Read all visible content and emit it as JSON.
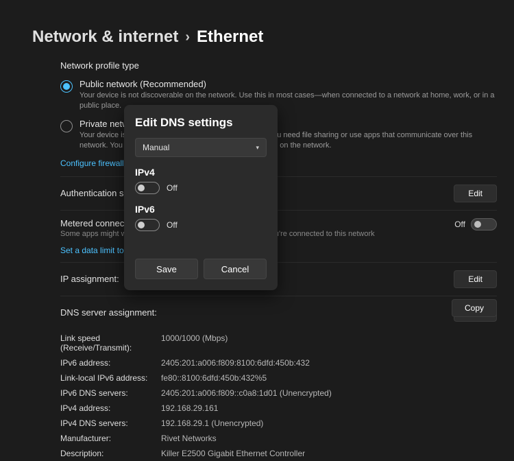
{
  "breadcrumb": {
    "parent": "Network & internet",
    "separator": "›",
    "current": "Ethernet"
  },
  "profile": {
    "section_label": "Network profile type",
    "public": {
      "title": "Public network (Recommended)",
      "desc": "Your device is not discoverable on the network. Use this in most cases—when connected to a network at home, work, or in a public place."
    },
    "private": {
      "title": "Private network",
      "desc": "Your device is discoverable on the network. Select this if you need file sharing or use apps that communicate over this network. You should know and trust the people and devices on the network."
    },
    "firewall_link": "Configure firewall and security settings"
  },
  "rows": {
    "auth": {
      "label": "Authentication settings",
      "button": "Edit"
    },
    "metered": {
      "label": "Metered connection",
      "desc": "Some apps might work differently to reduce data usage when you're connected to this network",
      "toggle_label": "Off"
    },
    "data_limit_link": "Set a data limit to help control data usage on this network",
    "ip": {
      "label": "IP assignment:",
      "button": "Edit"
    },
    "dns": {
      "label": "DNS server assignment:",
      "button": "Edit"
    }
  },
  "details": {
    "copy_button": "Copy",
    "items": [
      {
        "k": "Link speed (Receive/Transmit):",
        "v": "1000/1000 (Mbps)"
      },
      {
        "k": "IPv6 address:",
        "v": "2405:201:a006:f809:8100:6dfd:450b:432"
      },
      {
        "k": "Link-local IPv6 address:",
        "v": "fe80::8100:6dfd:450b:432%5"
      },
      {
        "k": "IPv6 DNS servers:",
        "v": "2405:201:a006:f809::c0a8:1d01 (Unencrypted)"
      },
      {
        "k": "IPv4 address:",
        "v": "192.168.29.161"
      },
      {
        "k": "IPv4 DNS servers:",
        "v": "192.168.29.1 (Unencrypted)"
      },
      {
        "k": "Manufacturer:",
        "v": "Rivet Networks"
      },
      {
        "k": "Description:",
        "v": "Killer E2500 Gigabit Ethernet Controller"
      }
    ]
  },
  "dialog": {
    "title": "Edit DNS settings",
    "dropdown_value": "Manual",
    "ipv4": {
      "label": "IPv4",
      "toggle": "Off"
    },
    "ipv6": {
      "label": "IPv6",
      "toggle": "Off"
    },
    "save": "Save",
    "cancel": "Cancel"
  }
}
